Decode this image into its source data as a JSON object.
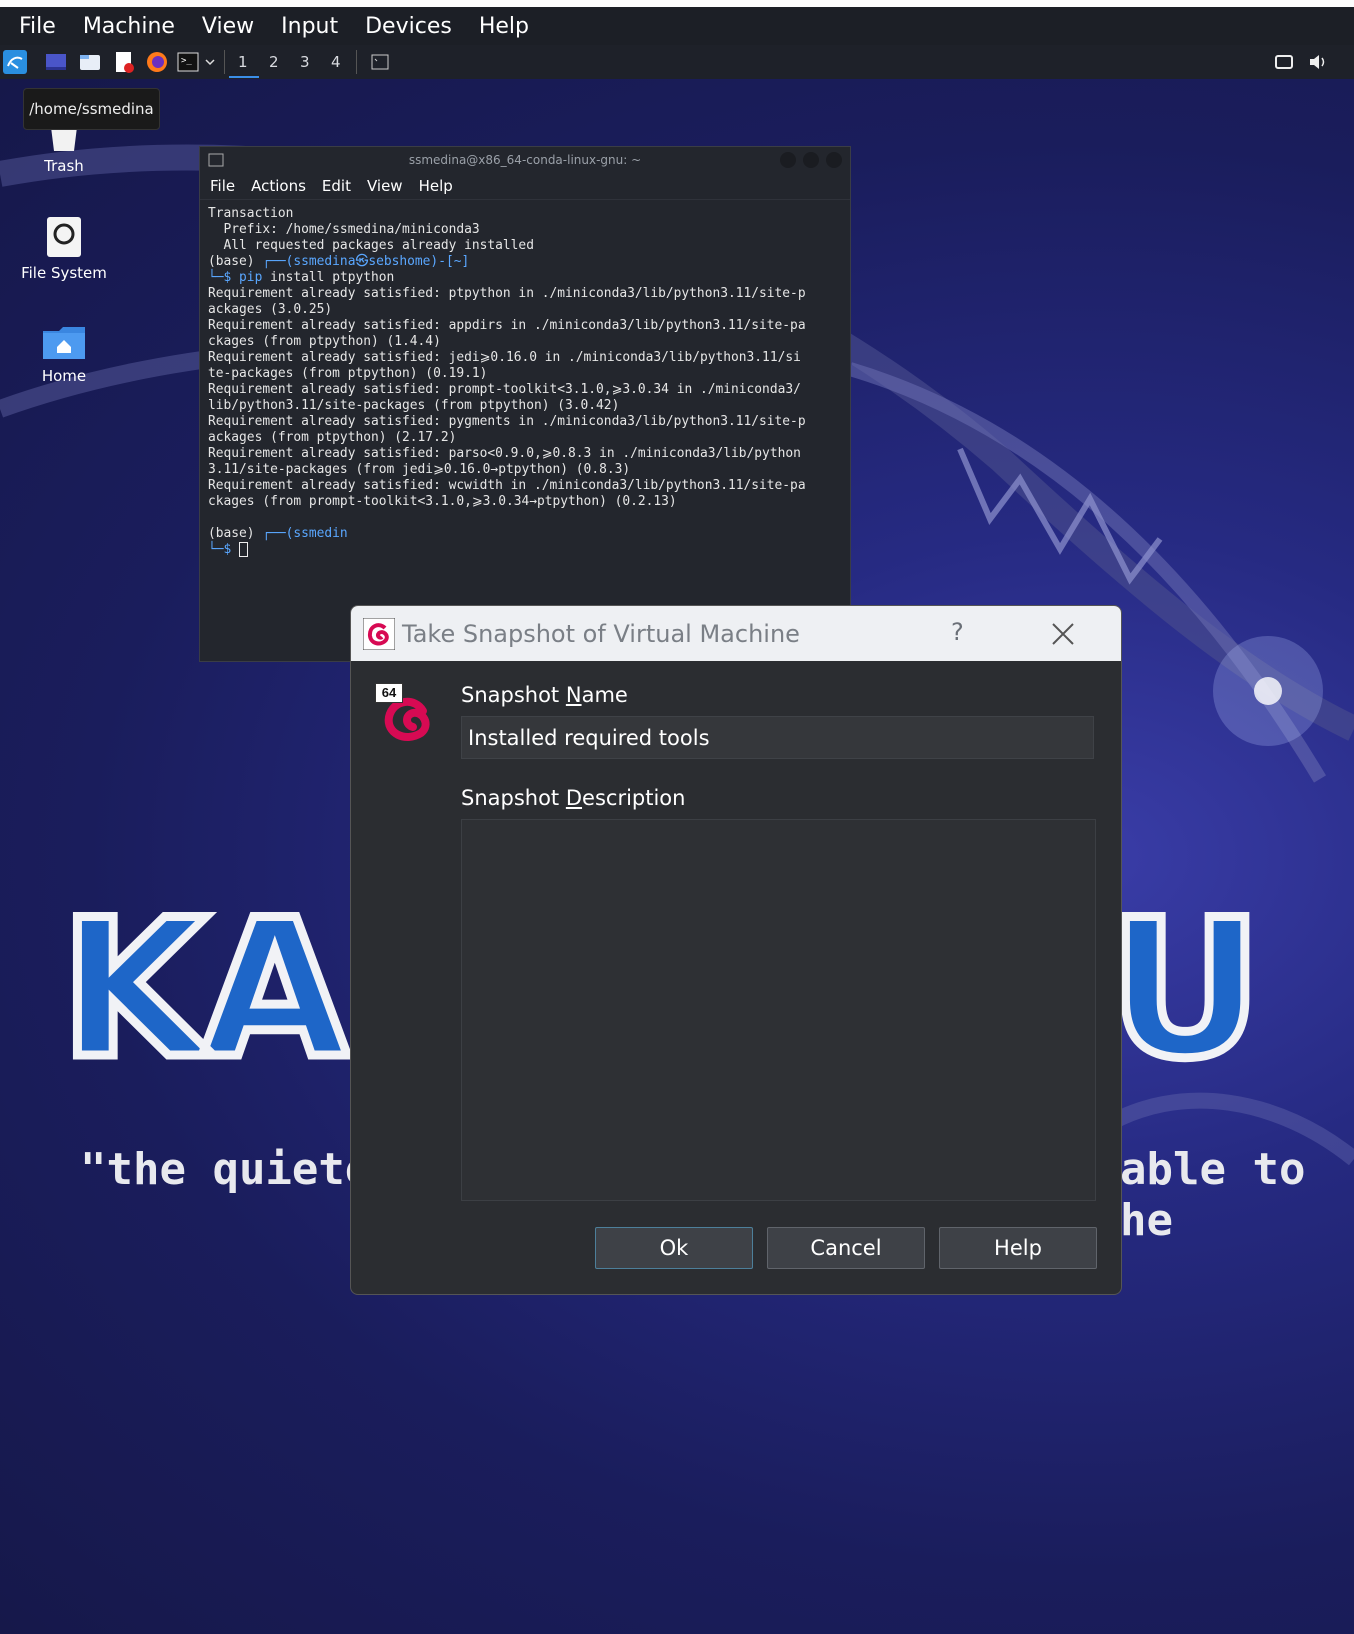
{
  "vbox_menu": [
    "File",
    "Machine",
    "View",
    "Input",
    "Devices",
    "Help"
  ],
  "taskbar": {
    "workspaces": [
      "1",
      "2",
      "3",
      "4"
    ]
  },
  "tooltip": "/home/ssmedina",
  "desktop_icons": [
    {
      "label": "Trash",
      "icon": "trash-icon"
    },
    {
      "label": "File System",
      "icon": "drive-icon"
    },
    {
      "label": "Home",
      "icon": "home-folder-icon"
    }
  ],
  "terminal": {
    "title": "ssmedina@x86_64-conda-linux-gnu: ~",
    "menu": [
      "File",
      "Actions",
      "Edit",
      "View",
      "Help"
    ],
    "lines": [
      "Transaction",
      "",
      "  Prefix: /home/ssmedina/miniconda3",
      "",
      "  All requested packages already installed",
      "",
      "",
      "Requirement already satisfied: ptpython in ./miniconda3/lib/python3.11/site-p",
      "ackages (3.0.25)",
      "Requirement already satisfied: appdirs in ./miniconda3/lib/python3.11/site-pa",
      "ckages (from ptpython) (1.4.4)",
      "Requirement already satisfied: jedi⩾0.16.0 in ./miniconda3/lib/python3.11/si",
      "te-packages (from ptpython) (0.19.1)",
      "Requirement already satisfied: prompt-toolkit<3.1.0,⩾3.0.34 in ./miniconda3/",
      "lib/python3.11/site-packages (from ptpython) (3.0.42)",
      "Requirement already satisfied: pygments in ./miniconda3/lib/python3.11/site-p",
      "ackages (from ptpython) (2.17.2)",
      "Requirement already satisfied: parso<0.9.0,⩾0.8.3 in ./miniconda3/lib/python",
      "3.11/site-packages (from jedi⩾0.16.0→ptpython) (0.8.3)",
      "Requirement already satisfied: wcwidth in ./miniconda3/lib/python3.11/site-pa",
      "ckages (from prompt-toolkit<3.1.0,⩾3.0.34→ptpython) (0.2.13)"
    ],
    "prompt1_base": "(base) ",
    "prompt1_user": "┌──(ssmedina㉿sebshome)-[~]",
    "prompt1_cmd_prefix": "└─$ ",
    "prompt1_cmd_pip": "pip",
    "prompt1_cmd_rest": " install ptpython",
    "prompt2_base": "(base) ",
    "prompt2_user": "┌──(ssmedin",
    "prompt2_cmd_prefix": "└─$ "
  },
  "dialog": {
    "title": "Take Snapshot of Virtual Machine",
    "help_glyph": "?",
    "badge": "64",
    "name_label_pre": "Snapshot ",
    "name_label_u": "N",
    "name_label_post": "ame",
    "name_value": "Installed required tools",
    "desc_label_pre": "Snapshot ",
    "desc_label_u": "D",
    "desc_label_post": "escription",
    "buttons": {
      "ok": "Ok",
      "cancel": "Cancel",
      "help": "Help"
    }
  },
  "wallpaper": {
    "logo_left": "KA",
    "logo_right": "U",
    "quote_left": "\"the quiete",
    "quote_right": "able to he"
  }
}
